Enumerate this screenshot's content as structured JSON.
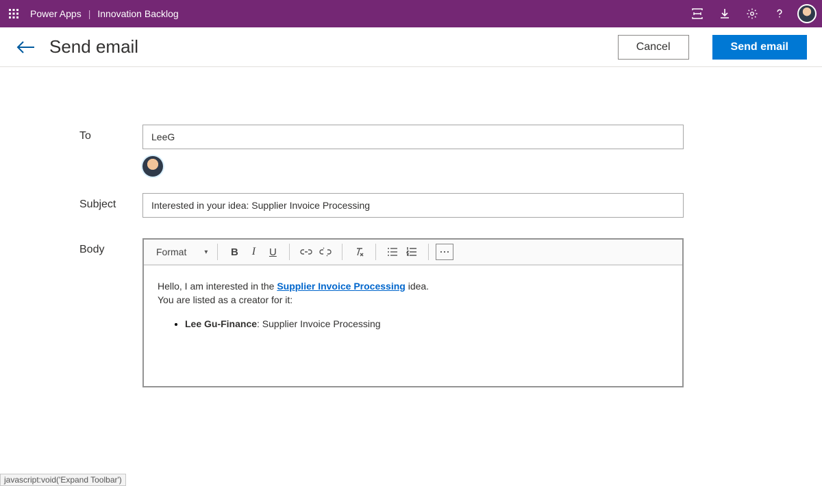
{
  "topbar": {
    "product": "Power Apps",
    "app": "Innovation Backlog"
  },
  "page": {
    "title": "Send email",
    "cancel": "Cancel",
    "send": "Send email"
  },
  "form": {
    "to_label": "To",
    "to_value": "LeeG",
    "subject_label": "Subject",
    "subject_value": "Interested in your idea: Supplier Invoice Processing",
    "body_label": "Body"
  },
  "toolbar": {
    "format": "Format",
    "bold": "B",
    "italic": "I",
    "underline": "U"
  },
  "body": {
    "line1_prefix": "Hello, I am interested in the ",
    "link_text": "Supplier Invoice Processing",
    "line1_suffix": " idea.",
    "line2": "You are listed as a creator for it:",
    "bullet_strong": "Lee Gu-Finance",
    "bullet_rest": ": Supplier Invoice Processing"
  },
  "status": "javascript:void('Expand Toolbar')"
}
